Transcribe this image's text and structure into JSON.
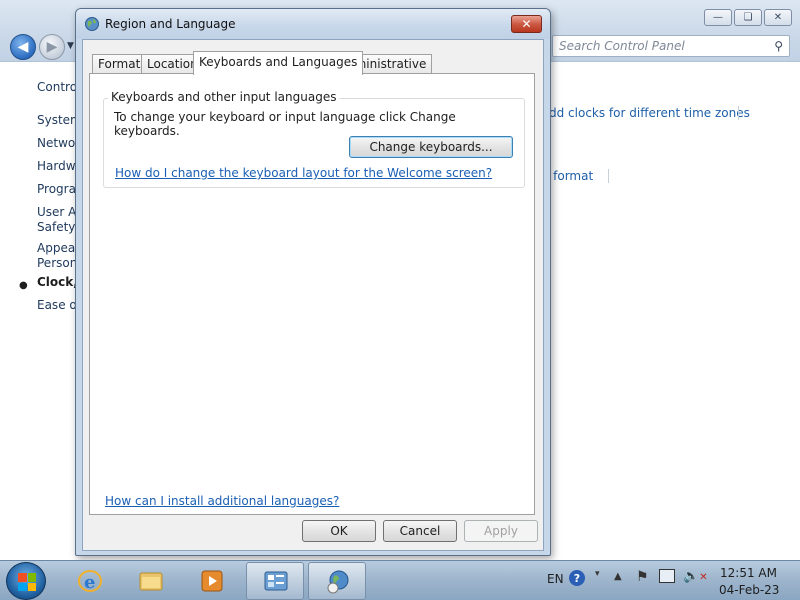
{
  "control_panel": {
    "search_placeholder": "Search Control Panel",
    "sidebar": [
      {
        "label": "Control Panel Home"
      },
      {
        "label": "System and Security"
      },
      {
        "label": "Network and Internet"
      },
      {
        "label": "Hardware and Sound"
      },
      {
        "label": "Programs"
      },
      {
        "label": "User Accounts and Family"
      },
      {
        "label": "Safety"
      },
      {
        "label": "Appearance and"
      },
      {
        "label": "Personalization"
      },
      {
        "label": "Clock, Language, and Region"
      },
      {
        "label": "Ease of Access"
      }
    ],
    "links": {
      "clocks": "dd clocks for different time zones",
      "format": "er format"
    }
  },
  "dialog": {
    "title": "Region and Language",
    "tabs": [
      {
        "label": "Formats"
      },
      {
        "label": "Location"
      },
      {
        "label": "Keyboards and Languages"
      },
      {
        "label": "Administrative"
      }
    ],
    "group_title": "Keyboards and other input languages",
    "group_text": "To change your keyboard or input language click Change keyboards.",
    "change_keyboards_label": "Change keyboards...",
    "welcome_link": "How do I change the keyboard layout for the Welcome screen?",
    "install_link": "How can I install additional languages?",
    "ok_label": "OK",
    "cancel_label": "Cancel",
    "apply_label": "Apply"
  },
  "taskbar": {
    "language": "EN",
    "time": "12:51 AM",
    "date": "04-Feb-23"
  }
}
